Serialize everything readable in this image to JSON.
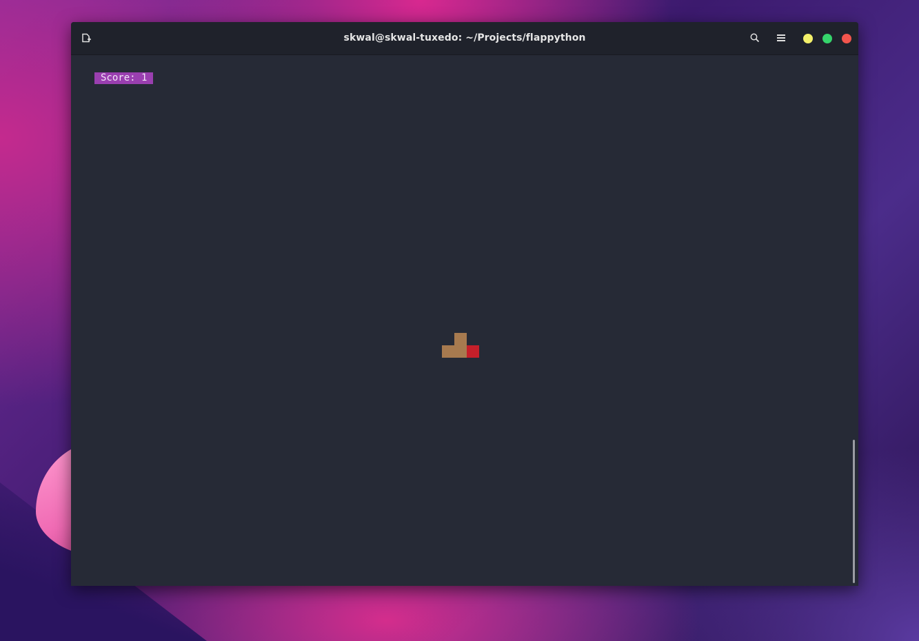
{
  "window": {
    "title": "skwal@skwal-tuxedo: ~/Projects/flappython"
  },
  "titlebar": {
    "new_tab_icon": "new-tab-icon",
    "search_icon": "search-icon",
    "menu_icon": "hamburger-menu-icon",
    "controls": {
      "minimize_color": "#f3f06a",
      "maximize_color": "#35d46b",
      "close_color": "#f2554d"
    }
  },
  "terminal": {
    "background": "#262a36",
    "score_text": "Score: 1",
    "score_background": "#9a3fb0",
    "bird": {
      "body_color": "#a77a4f",
      "beak_color": "#c51f2a"
    }
  }
}
